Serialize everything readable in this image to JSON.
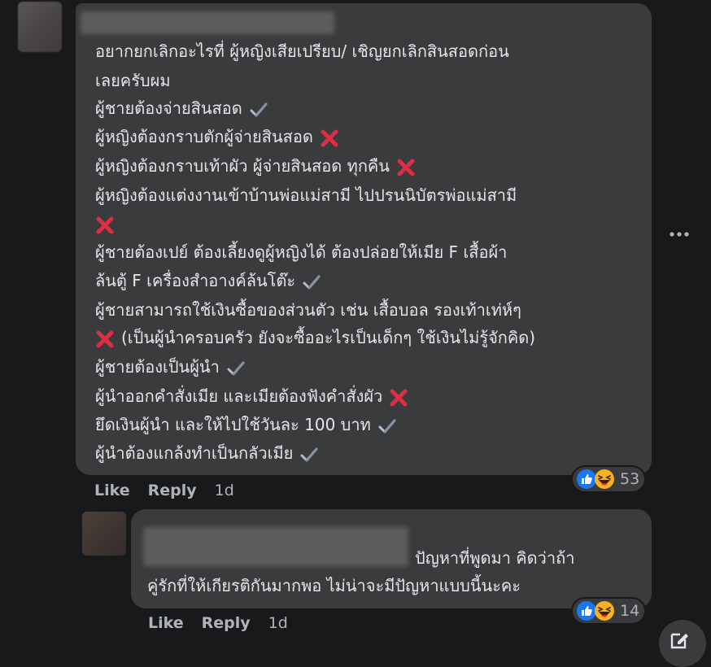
{
  "comment1": {
    "lines": [
      "อยากยกเลิกอะไรที่ ผู้หญิงเสียเปรียบ/ เชิญยกเลิกสินสอดก่อน",
      "เลยครับผม",
      "ผู้ชายต้องจ่ายสินสอด",
      "ผู้หญิงต้องกราบตักผู้จ่ายสินสอด",
      "ผู้หญิงต้องกราบเท้าผัว ผู้จ่ายสินสอด ทุกคืน",
      "ผู้หญิงต้องแต่งงานเข้าบ้านพ่อแม่สามี ไปปรนนิบัตรพ่อแม่สามี",
      "",
      "ผู้ชายต้องเปย์ ต้องเลี้ยงดูผู้หญิงได้ ต้องปล่อยให้เมีย F เสื้อผ้า",
      "ล้นตู้ F เครื่องสำอางค์ล้นโต๊ะ",
      "ผู้ชายสามารถใช้เงินซื้อของส่วนตัว เช่น เสื้อบอล รองเท้าเท่ห์ๆ",
      "(เป็นผู้นำครอบครัว ยังจะซื้ออะไรเป็นเด็กๆ ใช้เงินไม่รู้จักคิด)",
      "ผู้ชายต้องเป็นผู้นำ",
      "ผู้นำออกคำสั่งเมีย และเมียต้องฟังคำสั่งผัว",
      "ยึดเงินผู้นำ และให้ไปใช้วันละ 100 บาท",
      "ผู้นำต้องแกล้งทำเป็นกลัวเมีย"
    ],
    "like_label": "Like",
    "reply_label": "Reply",
    "time": "1d",
    "reaction_count": "53"
  },
  "comment2": {
    "line1": "ปัญหาที่พูดมา คิดว่าถ้า",
    "line2": "คู่รักที่ให้เกียรติกันมากพอ ไม่น่าจะมีปัญหาแบบนี้นะคะ",
    "like_label": "Like",
    "reply_label": "Reply",
    "time": "1d",
    "reaction_count": "14"
  },
  "icons": {
    "check": "check-mark-icon",
    "cross": "cross-mark-icon",
    "like": "like-reaction-icon",
    "haha": "haha-reaction-icon",
    "more": "more-options-icon",
    "edit": "new-message-icon"
  },
  "colors": {
    "background": "#18191a",
    "bubble": "#3a3b3c",
    "text": "#e4e6eb",
    "secondary": "#b0b3b8",
    "like_blue": "#1877f2",
    "cross_red": "#dd2e44"
  }
}
